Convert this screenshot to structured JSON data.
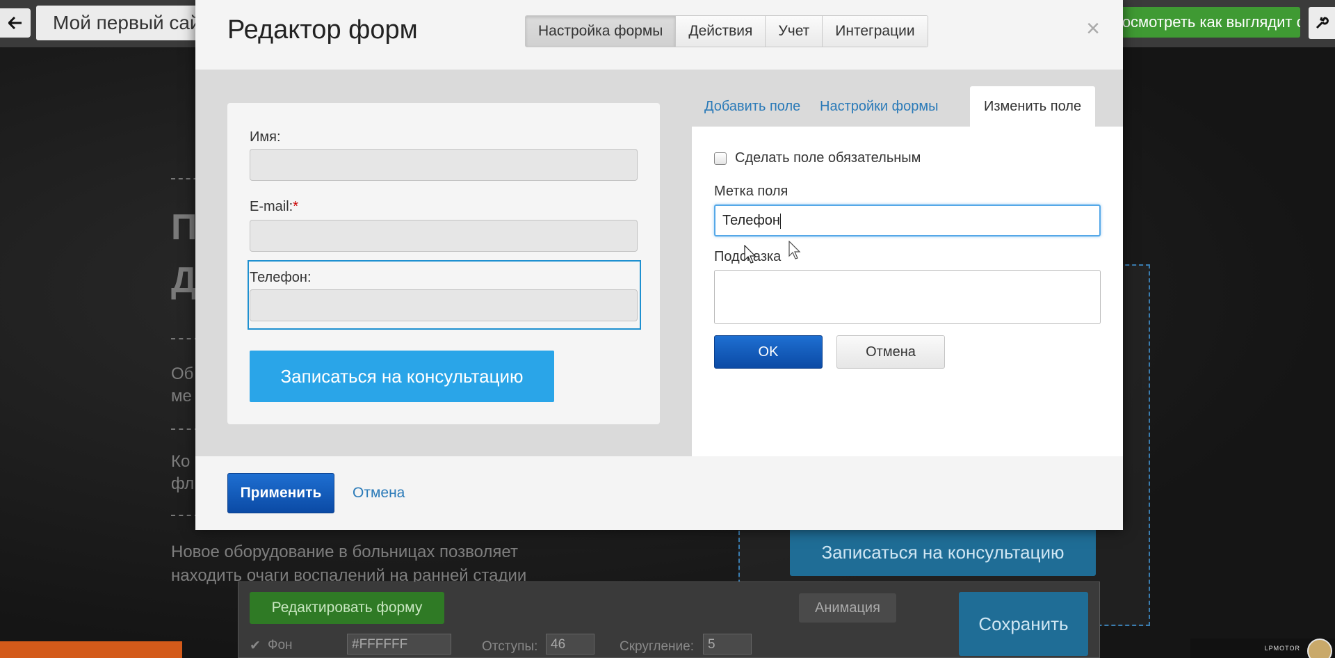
{
  "topbar": {
    "site_name": "Мой первый сайт",
    "preview_label": "Посмотреть как выглядит сайт",
    "back_icon": "arrow-left-icon",
    "wrench_icon": "wrench-icon"
  },
  "background": {
    "heading_1": "П",
    "heading_2": "Д",
    "text_1a": "Об",
    "text_1b": "ме",
    "text_2a": "Ко",
    "text_2b": "фл",
    "text_3a": "Новое оборудование в больницах позволяет",
    "text_3b": "находить очаги воспалений на ранней стадии",
    "cta_label": "Записаться на консультацию"
  },
  "panel": {
    "edit_form_label": "Редактировать форму",
    "animation_label": "Анимация",
    "save_label": "Сохранить",
    "bg_label": "Фон",
    "bg_color": "#FFFFFF",
    "padding_label": "Отступы:",
    "padding_value": "46",
    "rounding_label": "Скругление:",
    "rounding_value": "5"
  },
  "modal": {
    "title": "Редактор форм",
    "tabs": [
      {
        "label": "Настройка формы",
        "active": true
      },
      {
        "label": "Действия",
        "active": false
      },
      {
        "label": "Учет",
        "active": false
      },
      {
        "label": "Интеграции",
        "active": false
      }
    ],
    "close_icon": "close-icon",
    "preview": {
      "name_label": "Имя:",
      "email_label": "E-mail:",
      "required_mark": "*",
      "phone_label": "Телефон:",
      "submit_label": "Записаться на консультацию"
    },
    "side_tabs": [
      {
        "label": "Добавить поле",
        "active": false
      },
      {
        "label": "Настройки формы",
        "active": false
      },
      {
        "label": "Изменить поле",
        "active": true
      }
    ],
    "edit": {
      "required_checkbox_label": "Сделать поле обязательным",
      "required_checked": false,
      "field_label_title": "Метка поля",
      "field_label_value": "Телефон",
      "hint_title": "Подсказка",
      "hint_value": "",
      "ok_label": "OK",
      "cancel_label": "Отмена"
    },
    "footer": {
      "apply_label": "Применить",
      "cancel_label": "Отмена"
    }
  },
  "corner": {
    "logo_text": "LPMOTOR"
  },
  "colors": {
    "accent_blue": "#2aa5e8",
    "primary_blue": "#0b4aa5",
    "link_blue": "#2a7ab8",
    "green": "#3f9a33",
    "required_red": "#cc0000"
  }
}
